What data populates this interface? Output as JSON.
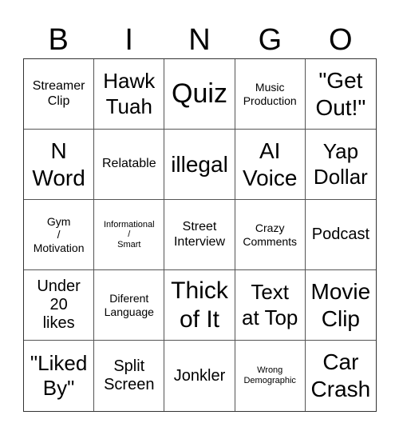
{
  "header": [
    "B",
    "I",
    "N",
    "G",
    "O"
  ],
  "cells": [
    "Streamer\nClip",
    "Hawk\nTuah",
    "Quiz",
    "Music\nProduction",
    "\"Get\nOut!\"",
    "N\nWord",
    "Relatable",
    "illegal",
    "AI\nVoice",
    "Yap\nDollar",
    "Gym\n/\nMotivation",
    "Informational\n/\nSmart",
    "Street\nInterview",
    "Crazy\nComments",
    "Podcast",
    "Under\n20\nlikes",
    "Diferent\nLanguage",
    "Thick\nof It",
    "Text\nat Top",
    "Movie\nClip",
    "\"Liked\nBy\"",
    "Split\nScreen",
    "Jonkler",
    "Wrong\nDemographic",
    "Car\nCrash"
  ]
}
